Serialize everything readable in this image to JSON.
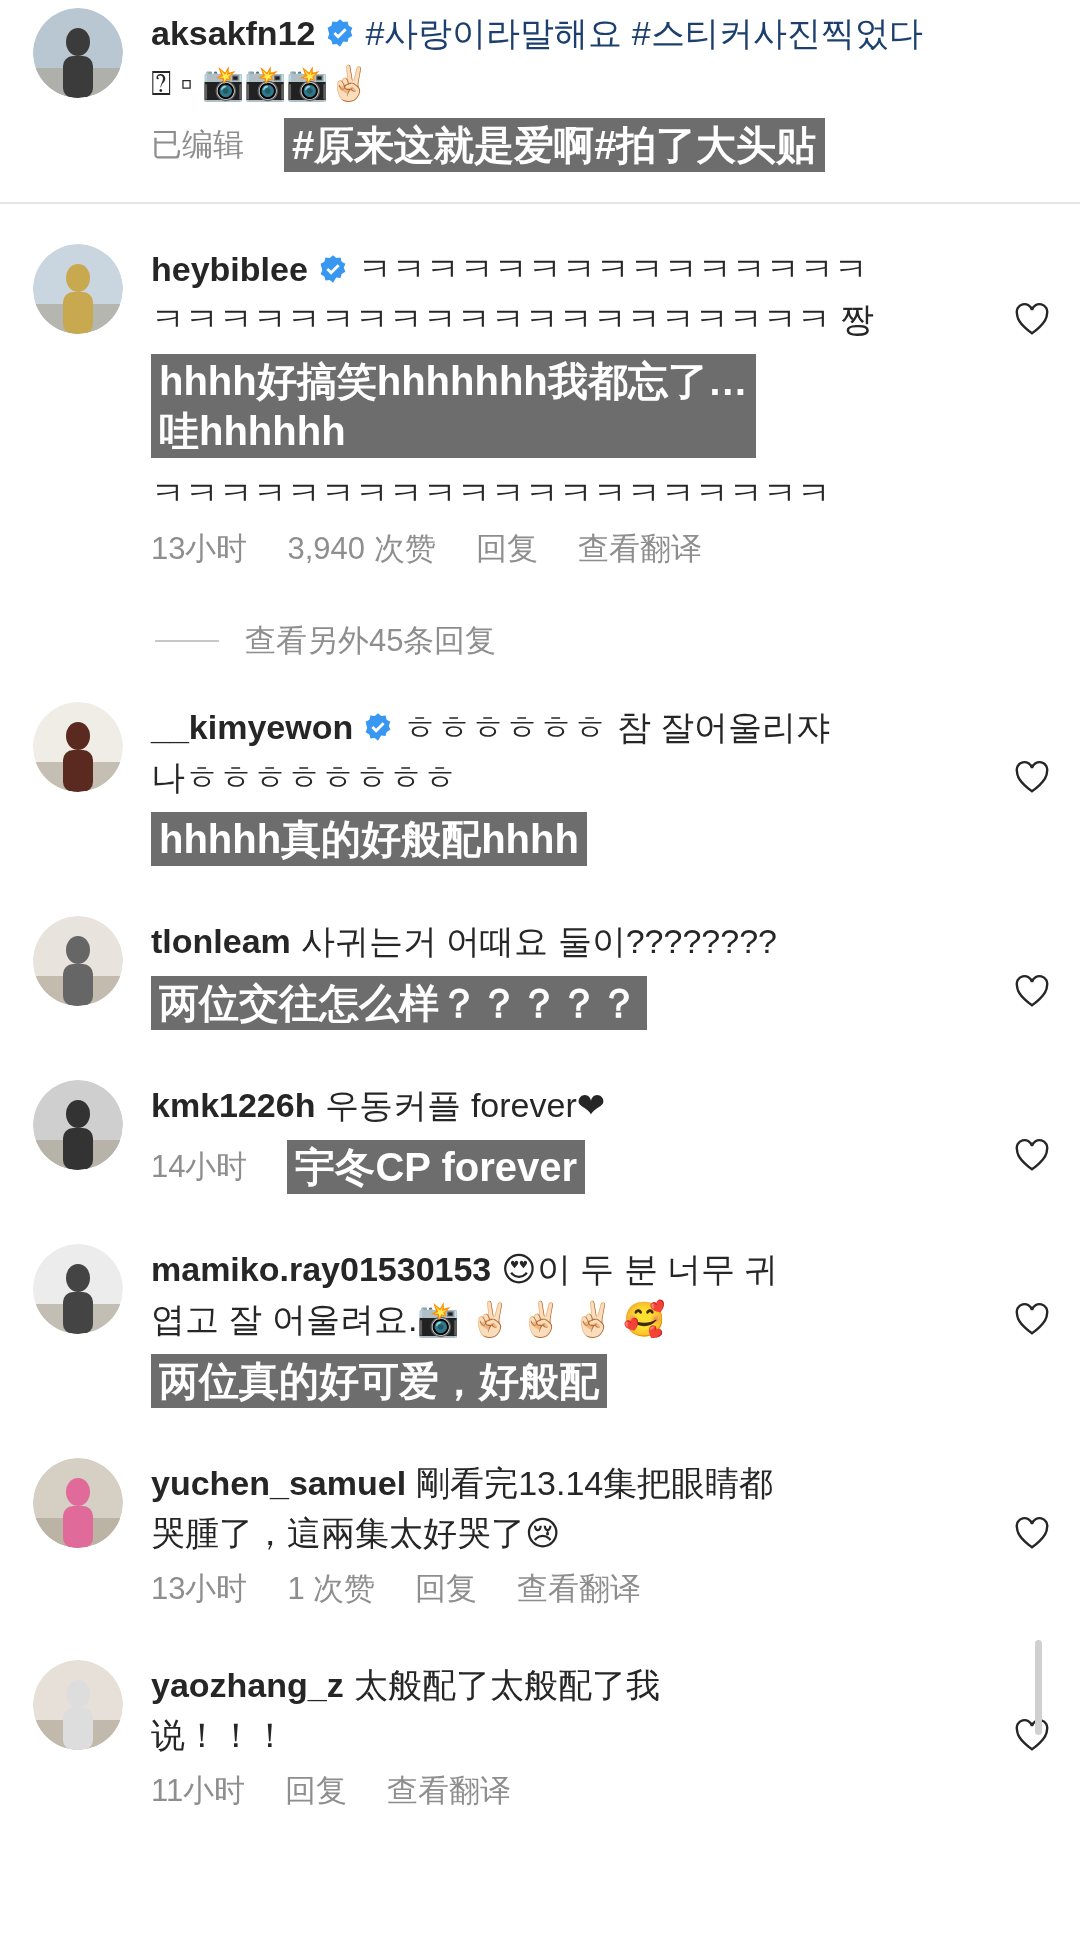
{
  "comments": [
    {
      "kind": "comment",
      "username": "aksakfn12",
      "verified": true,
      "tags": "#사랑이라말해요 #스티커사진찍었다",
      "lines": [
        "⍰ ▫ 📸📸📸✌🏻"
      ],
      "edited": "已编辑",
      "caption": "#原来这就是爱啊#拍了大头贴",
      "divider": true
    },
    {
      "kind": "comment",
      "username": "heybiblee",
      "verified": true,
      "lines": [
        "ㅋㅋㅋㅋㅋㅋㅋㅋㅋㅋㅋㅋㅋㅋㅋ",
        "ㅋㅋㅋㅋㅋㅋㅋㅋㅋㅋㅋㅋㅋㅋㅋㅋㅋㅋㅋㅋ 짱"
      ],
      "caption": "hhhh好搞笑hhhhhhh我都忘了…\n哇hhhhhh",
      "after": "ㅋㅋㅋㅋㅋㅋㅋㅋㅋㅋㅋㅋㅋㅋㅋㅋㅋㅋㅋㅋ",
      "meta": [
        "13小时",
        "3,940 次赞",
        "回复",
        "查看翻译"
      ]
    },
    {
      "kind": "replies",
      "label": "查看另外45条回复"
    },
    {
      "kind": "comment",
      "username": "__kimyewon",
      "verified": true,
      "lines": [
        "ㅎㅎㅎㅎㅎㅎ 참 잘어울리쟈",
        "나ㅎㅎㅎㅎㅎㅎㅎㅎ"
      ],
      "caption": "hhhhh真的好般配hhhh"
    },
    {
      "kind": "comment",
      "username": "tlonleam",
      "verified": false,
      "lines": [
        "사귀는거 어때요 둘이????????"
      ],
      "caption": "两位交往怎么样？？？？？"
    },
    {
      "kind": "comment",
      "username": "kmk1226h",
      "verified": false,
      "lines": [
        "우동커플  forever❤"
      ],
      "caption": "宇冬CP forever",
      "meta": [
        "14小时"
      ]
    },
    {
      "kind": "comment",
      "username": "mamiko.ray01530153",
      "verified": false,
      "lines": [
        "😍이 두 분 너무 귀",
        "엽고 잘 어울려요.📸 ✌🏻 ✌🏻 ✌🏻 🥰"
      ],
      "caption": "两位真的好可爱，好般配"
    },
    {
      "kind": "comment",
      "username": "yuchen_samuel",
      "verified": false,
      "lines": [
        "剛看完13.14集把眼睛都",
        "哭腫了，這兩集太好哭了😢"
      ],
      "meta": [
        "13小时",
        "1 次赞",
        "回复",
        "查看翻译"
      ]
    },
    {
      "kind": "comment",
      "username": "yaozhang_z",
      "verified": false,
      "lines": [
        "太般配了太般配了我",
        "说！！！"
      ],
      "meta": [
        "11小时",
        "回复",
        "查看翻译"
      ]
    }
  ]
}
